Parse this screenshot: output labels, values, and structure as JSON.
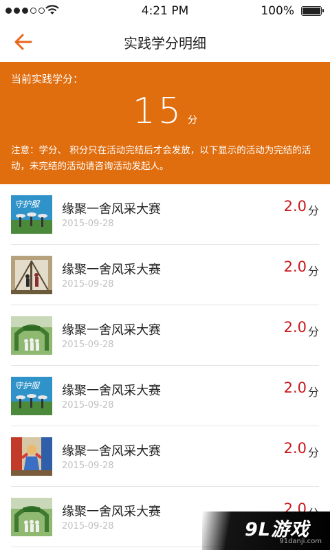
{
  "status_bar": {
    "time": "4:21 PM",
    "battery": "100%"
  },
  "nav": {
    "title": "实践学分明细"
  },
  "summary": {
    "label": "当前实践学分：",
    "score": "15",
    "unit": "分",
    "notice": "注意：学分、 积分只在活动完结后才会发放，以下显示的活动为完结的活动，未完结的活动请咨询活动发起人。"
  },
  "activities": [
    {
      "title": "缘聚一舍风采大赛",
      "date": "2015-09-28",
      "credit": "2.0",
      "unit": "分",
      "thumb_text": "守护服"
    },
    {
      "title": "缘聚一舍风采大赛",
      "date": "2015-09-28",
      "credit": "2.0",
      "unit": "分"
    },
    {
      "title": "缘聚一舍风采大赛",
      "date": "2015-09-28",
      "credit": "2.0",
      "unit": "分"
    },
    {
      "title": "缘聚一舍风采大赛",
      "date": "2015-09-28",
      "credit": "2.0",
      "unit": "分",
      "thumb_text": "守护服"
    },
    {
      "title": "缘聚一舍风采大赛",
      "date": "2015-09-28",
      "credit": "2.0",
      "unit": "分"
    },
    {
      "title": "缘聚一舍风采大赛",
      "date": "2015-09-28",
      "credit": "2.0",
      "unit": "分"
    }
  ],
  "watermark": {
    "logo": "9L游戏",
    "domain": "91danji.com"
  },
  "colors": {
    "accent": "#e06d0e",
    "credit": "#c8181c",
    "back_arrow": "#e8651a"
  }
}
